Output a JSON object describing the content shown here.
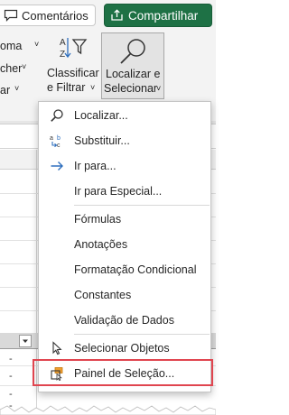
{
  "topbar": {
    "comments_label": "Comentários",
    "share_label": "Compartilhar",
    "comments_icon": "comment-icon",
    "share_icon": "share-icon"
  },
  "ribbon": {
    "left_fragments": [
      "oma",
      "cher",
      "ar"
    ],
    "sort_filter_label_line1": "Classificar",
    "sort_filter_label_line2": "e Filtrar",
    "find_select_label_line1": "Localizar e",
    "find_select_label_line2": "Selecionar",
    "caret": "˅"
  },
  "menu": {
    "items": [
      {
        "label": "Localizar...",
        "icon": "search-icon"
      },
      {
        "label": "Substituir...",
        "icon": "replace-icon"
      },
      {
        "label": "Ir para...",
        "icon": "arrow-right-icon"
      },
      {
        "label": "Ir para Especial...",
        "icon": ""
      },
      {
        "label": "Fórmulas",
        "icon": ""
      },
      {
        "label": "Anotações",
        "icon": ""
      },
      {
        "label": "Formatação Condicional",
        "icon": ""
      },
      {
        "label": "Constantes",
        "icon": ""
      },
      {
        "label": "Validação de Dados",
        "icon": ""
      },
      {
        "label": "Selecionar Objetos",
        "icon": "pointer-icon"
      },
      {
        "label": "Painel de Seleção...",
        "icon": "selection-pane-icon"
      }
    ]
  },
  "sheet": {
    "dash_cells": [
      "-",
      "-",
      "-",
      "-"
    ]
  },
  "colors": {
    "accent_green": "#1e7145",
    "highlight_red": "#e0454f",
    "arrow_blue": "#2f6fbd"
  }
}
